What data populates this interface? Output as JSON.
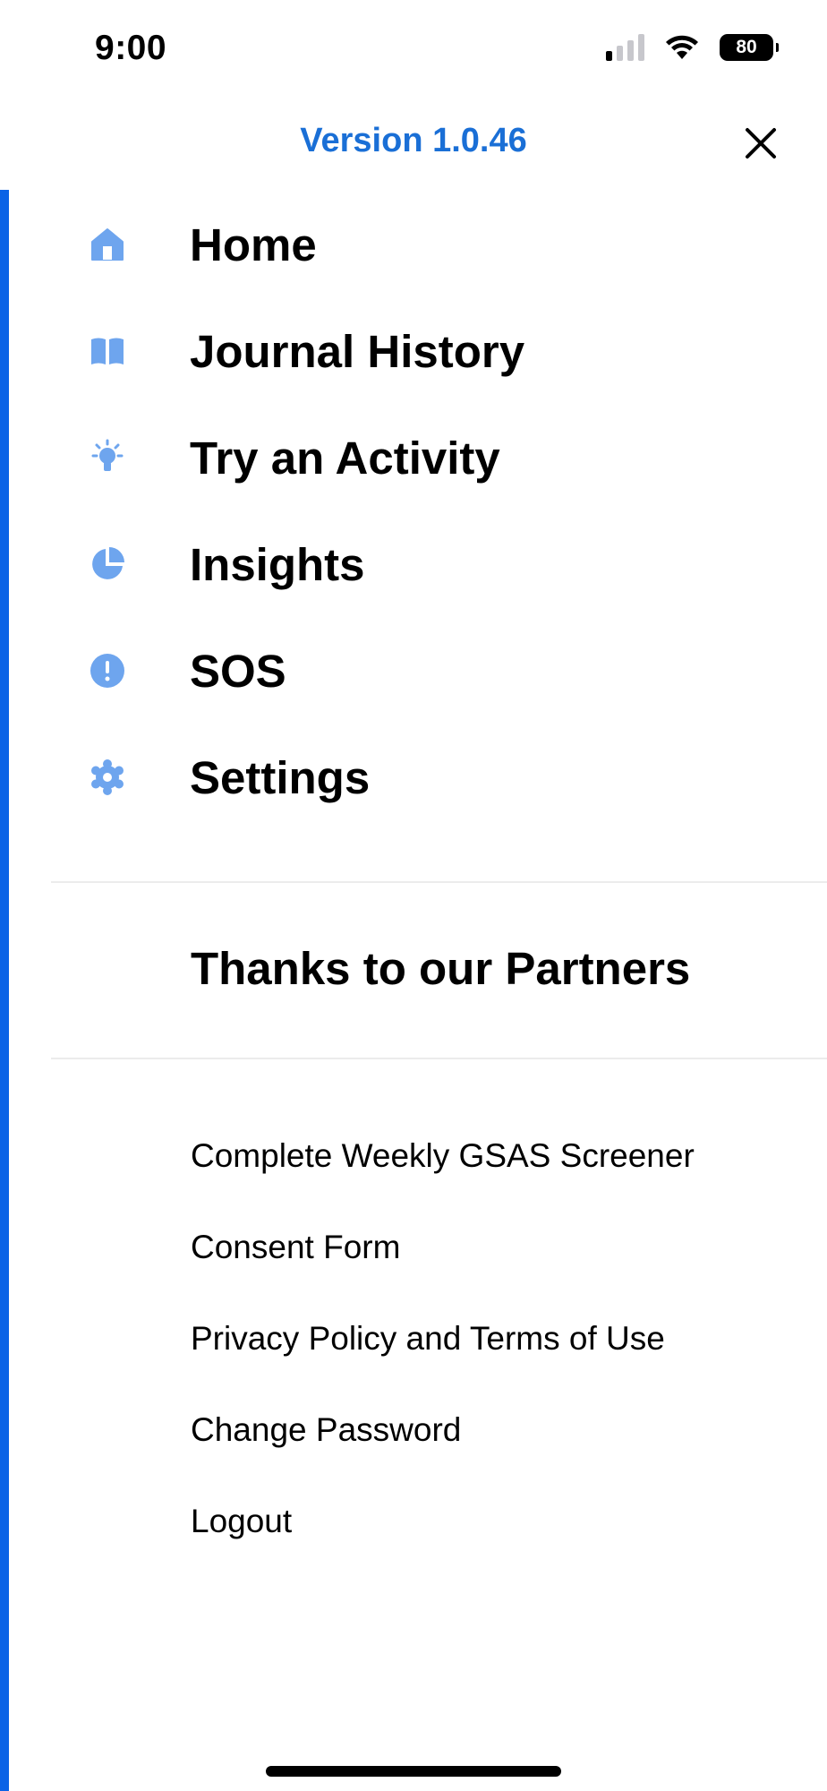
{
  "status_bar": {
    "time": "9:00",
    "battery": "80",
    "icons": [
      "signal-icon",
      "wifi-icon",
      "battery-icon"
    ]
  },
  "header": {
    "version": "Version 1.0.46",
    "close_icon": "close-icon"
  },
  "colors": {
    "accent": "#1a6fd6",
    "sidebar_bar": "#0a63e6",
    "nav_icon": "#6ea5ee"
  },
  "nav": {
    "items": [
      {
        "label": "Home",
        "icon": "home-icon"
      },
      {
        "label": "Journal History",
        "icon": "book-icon"
      },
      {
        "label": "Try an Activity",
        "icon": "lightbulb-icon"
      },
      {
        "label": "Insights",
        "icon": "pie-chart-icon"
      },
      {
        "label": "SOS",
        "icon": "alert-icon"
      },
      {
        "label": "Settings",
        "icon": "gear-icon"
      }
    ]
  },
  "partners": {
    "label": "Thanks to our Partners"
  },
  "links": {
    "items": [
      {
        "label": "Complete Weekly GSAS Screener"
      },
      {
        "label": "Consent Form"
      },
      {
        "label": "Privacy Policy and Terms of Use"
      },
      {
        "label": "Change Password"
      },
      {
        "label": "Logout"
      }
    ]
  }
}
